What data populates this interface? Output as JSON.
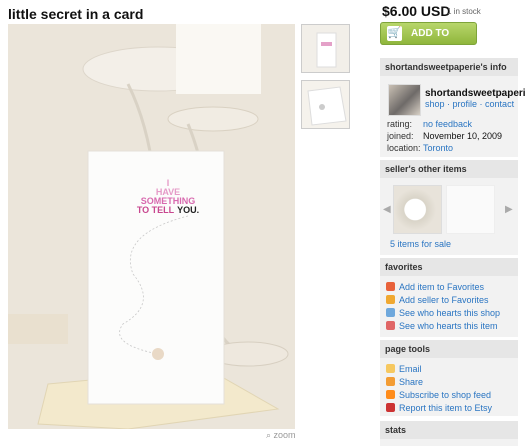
{
  "listing": {
    "title": "little secret in a card",
    "price": "$6.00 USD",
    "stock": "1 in stock",
    "add_to_cart": "ADD TO CART",
    "zoom": "zoom",
    "card_lines": [
      "I",
      "HAVE",
      "SOMETHING",
      "TO TELL",
      "YOU."
    ]
  },
  "seller": {
    "heading": "shortandsweetpaperie's info",
    "name": "shortandsweetpaperie",
    "links": [
      "shop",
      "profile",
      "contact"
    ],
    "rating_label": "rating:",
    "rating_value": "no feedback",
    "joined_label": "joined:",
    "joined_value": "November 10, 2009",
    "location_label": "location:",
    "location_value": "Toronto"
  },
  "other_items": {
    "heading": "seller's other items",
    "count": "5 items for sale"
  },
  "favorites": {
    "heading": "favorites",
    "items": [
      "Add item to Favorites",
      "Add seller to Favorites",
      "See who hearts this shop",
      "See who hearts this item"
    ]
  },
  "page_tools": {
    "heading": "page tools",
    "items": [
      "Email",
      "Share",
      "Subscribe to shop feed",
      "Report this item to Etsy"
    ]
  },
  "stats": {
    "heading": "stats"
  },
  "colors": {
    "cart_green": "#8fb63c",
    "link_blue": "#2a75c2",
    "card_pink": "#e05aa8"
  }
}
